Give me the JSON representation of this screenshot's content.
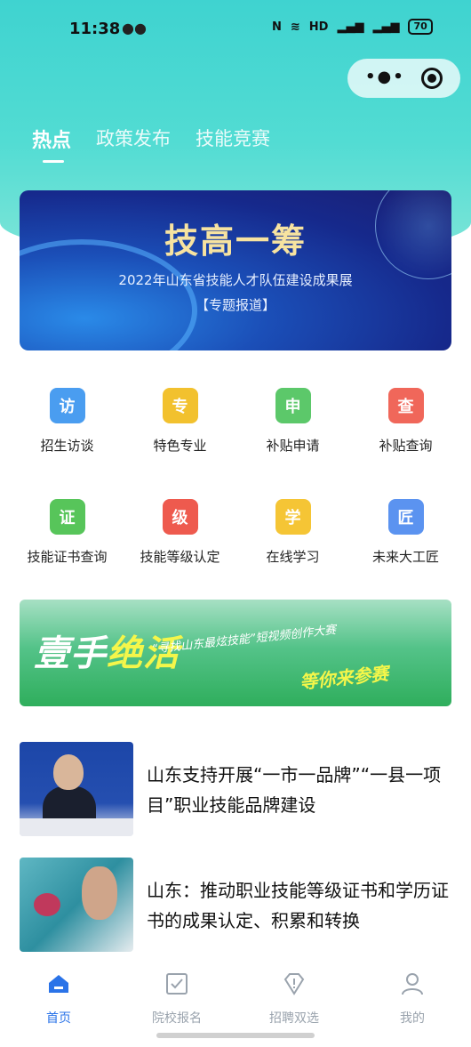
{
  "status_bar": {
    "time": "11:38",
    "battery": "70"
  },
  "tabs": [
    {
      "label": "热点"
    },
    {
      "label": "政策发布"
    },
    {
      "label": "技能竞赛"
    }
  ],
  "banner": {
    "title": "技高一筹",
    "subtitle": "2022年山东省技能人才队伍建设成果展",
    "tag": "【专题报道】"
  },
  "grid": [
    {
      "label": "招生访谈",
      "icon": "student-interview-icon",
      "color": "#4a9df0",
      "glyph": "访"
    },
    {
      "label": "特色专业",
      "icon": "featured-major-icon",
      "color": "#f2c12e",
      "glyph": "专"
    },
    {
      "label": "补贴申请",
      "icon": "subsidy-apply-icon",
      "color": "#5cc86a",
      "glyph": "申"
    },
    {
      "label": "补贴查询",
      "icon": "subsidy-query-icon",
      "color": "#f0675a",
      "glyph": "查"
    },
    {
      "label": "技能证书查询",
      "icon": "certificate-query-icon",
      "color": "#57c55a",
      "glyph": "证"
    },
    {
      "label": "技能等级认定",
      "icon": "skill-level-icon",
      "color": "#ee5a4e",
      "glyph": "级"
    },
    {
      "label": "在线学习",
      "icon": "online-learning-icon",
      "color": "#f5c535",
      "glyph": "学"
    },
    {
      "label": "未来大工匠",
      "icon": "future-craftsman-icon",
      "color": "#5b93f0",
      "glyph": "匠"
    }
  ],
  "promo": {
    "main_a": "壹手",
    "main_b": "绝活",
    "sub": "“寻找山东最炫技能”短视频创作大赛",
    "cta": "等你来参赛"
  },
  "news": [
    {
      "title": "山东支持开展“一市一品牌”“一县一项目”职业技能品牌建设"
    },
    {
      "title": "山东：推动职业技能等级证书和学历证书的成果认定、积累和转换"
    }
  ],
  "tabbar": [
    {
      "label": "首页",
      "icon": "home-icon",
      "active": true
    },
    {
      "label": "院校报名",
      "icon": "checkbox-icon",
      "active": false
    },
    {
      "label": "招聘双选",
      "icon": "diamond-alert-icon",
      "active": false
    },
    {
      "label": "我的",
      "icon": "user-icon",
      "active": false
    }
  ],
  "colors": {
    "accent": "#2a73e8",
    "header_gradient": "#3fd3d0"
  }
}
